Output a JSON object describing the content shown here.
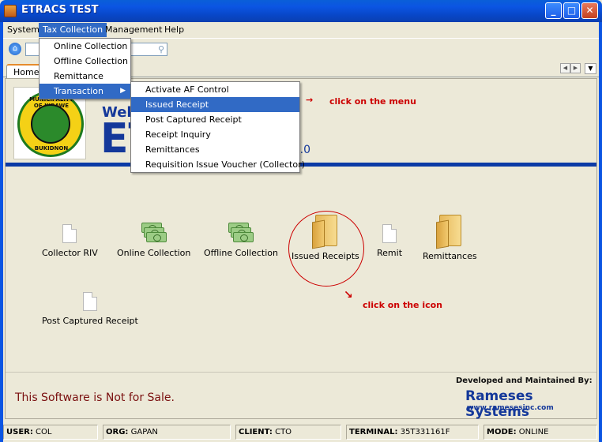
{
  "window": {
    "title": "ETRACS TEST"
  },
  "menubar": {
    "items": [
      "System",
      "Tax Collection",
      "Management",
      "Help"
    ]
  },
  "tax_collection_menu": [
    "Online Collection",
    "Offline Collection",
    "Remittance",
    "Transaction"
  ],
  "transaction_menu": [
    "Activate AF Control",
    "Issued Receipt",
    "Post Captured Receipt",
    "Receipt Inquiry",
    "Remittances",
    "Requisition Issue Voucher (Collector)"
  ],
  "tabs": {
    "home": "Home"
  },
  "header": {
    "welcome": "Wel",
    "title": "ET",
    "version": "ion 2.0",
    "seal_top": "MUNICIPALITY OF KIBAWE",
    "seal_bottom": "BUKIDNON"
  },
  "icons": [
    {
      "label": "Collector RIV"
    },
    {
      "label": "Online Collection"
    },
    {
      "label": "Offline Collection"
    },
    {
      "label": "Issued Receipts"
    },
    {
      "label": "Remit"
    },
    {
      "label": "Remittances"
    },
    {
      "label": "Post Captured Receipt"
    }
  ],
  "annotations": {
    "menu": "click on the menu",
    "icon": "click on the icon"
  },
  "footer": {
    "not_for_sale": "This Software is Not for Sale.",
    "developed_by": "Developed and Maintained By:",
    "company": "Rameses Systems",
    "url": "www.ramesesinc.com"
  },
  "status": [
    {
      "key": "USER:",
      "value": "COL"
    },
    {
      "key": "ORG:",
      "value": "GAPAN"
    },
    {
      "key": "CLIENT:",
      "value": "CTO"
    },
    {
      "key": "TERMINAL:",
      "value": "35T331161F"
    },
    {
      "key": "MODE:",
      "value": "ONLINE"
    }
  ]
}
